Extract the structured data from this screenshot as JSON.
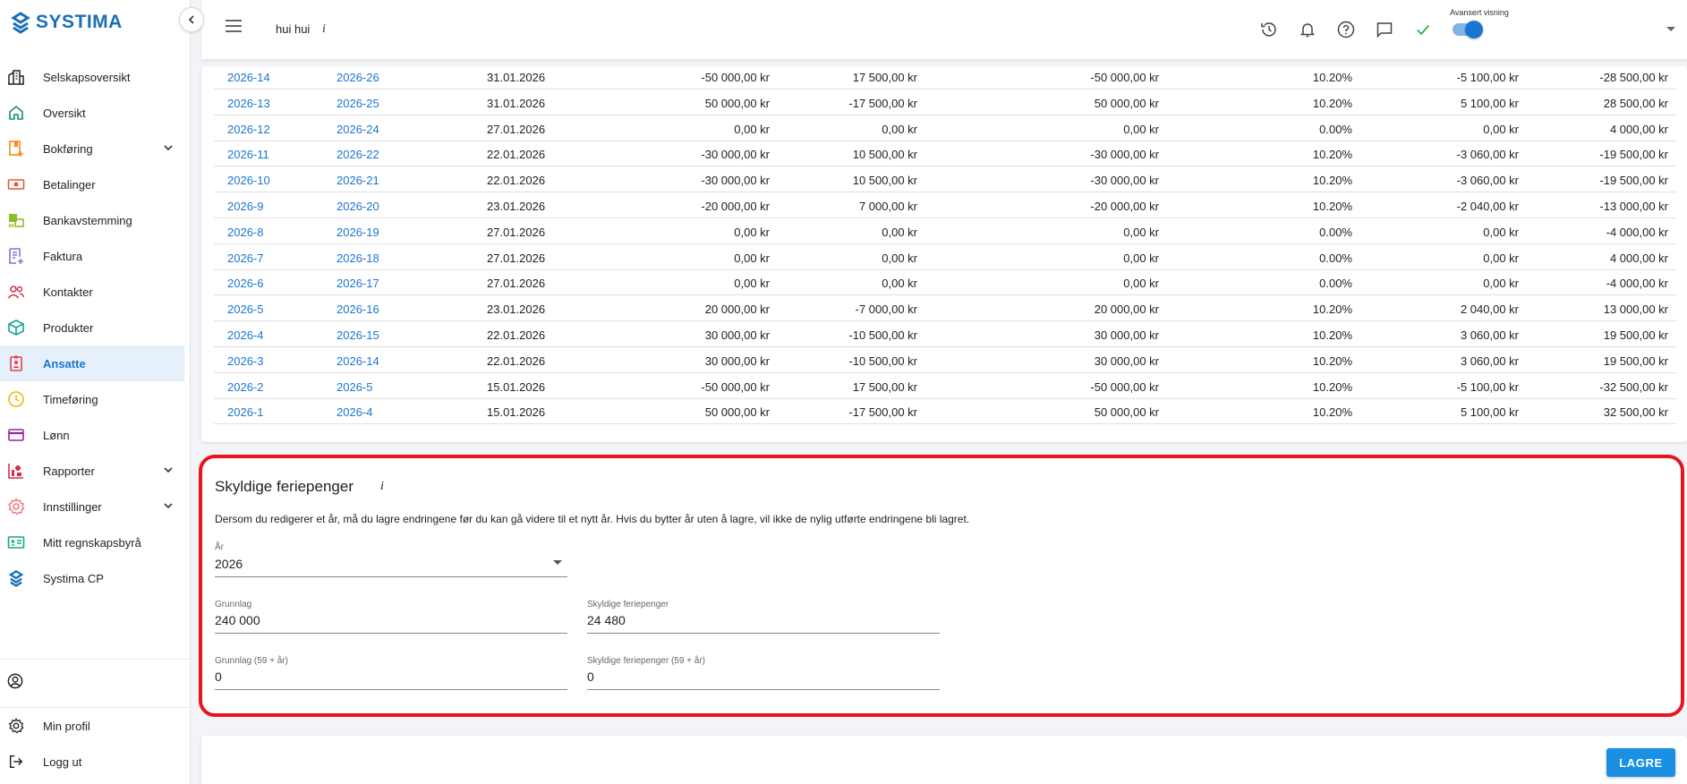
{
  "app": {
    "logo_text": "SYSTIMA",
    "brand_color": "#1a6fb5",
    "accent_color": "#1a76d2",
    "highlight_color": "#e8141e"
  },
  "sidebar": {
    "items": [
      {
        "label": "Selskapsoversikt",
        "icon": "buildings-icon"
      },
      {
        "label": "Oversikt",
        "icon": "home-icon"
      },
      {
        "label": "Bokføring",
        "icon": "ledger-icon",
        "expandable": true
      },
      {
        "label": "Betalinger",
        "icon": "payments-icon"
      },
      {
        "label": "Bankavstemming",
        "icon": "bank-reconciliation-icon"
      },
      {
        "label": "Faktura",
        "icon": "invoice-icon"
      },
      {
        "label": "Kontakter",
        "icon": "contacts-icon"
      },
      {
        "label": "Produkter",
        "icon": "box-icon"
      },
      {
        "label": "Ansatte",
        "icon": "employee-badge-icon",
        "active": true
      },
      {
        "label": "Timeføring",
        "icon": "clock-icon"
      },
      {
        "label": "Lønn",
        "icon": "card-icon"
      },
      {
        "label": "Rapporter",
        "icon": "reports-icon",
        "expandable": true
      },
      {
        "label": "Innstillinger",
        "icon": "gear-icon",
        "expandable": true
      },
      {
        "label": "Mitt regnskapsbyrå",
        "icon": "id-card-icon"
      },
      {
        "label": "Systima CP",
        "icon": "systima-logo-icon"
      }
    ],
    "bottom": {
      "profile_label": "Min profil",
      "logout_label": "Logg ut"
    }
  },
  "topbar": {
    "company_name": "hui hui",
    "info_glyph": "i",
    "advanced_view_label": "Avansert visning",
    "advanced_view_on": true
  },
  "table": {
    "rows": [
      [
        "2026-14",
        "2026-26",
        "31.01.2026",
        "-50 000,00 kr",
        "17 500,00 kr",
        "-50 000,00 kr",
        "10.20%",
        "-5 100,00 kr",
        "-28 500,00 kr"
      ],
      [
        "2026-13",
        "2026-25",
        "31.01.2026",
        "50 000,00 kr",
        "-17 500,00 kr",
        "50 000,00 kr",
        "10.20%",
        "5 100,00 kr",
        "28 500,00 kr"
      ],
      [
        "2026-12",
        "2026-24",
        "27.01.2026",
        "0,00 kr",
        "0,00 kr",
        "0,00 kr",
        "0.00%",
        "0,00 kr",
        "4 000,00 kr"
      ],
      [
        "2026-11",
        "2026-22",
        "22.01.2026",
        "-30 000,00 kr",
        "10 500,00 kr",
        "-30 000,00 kr",
        "10.20%",
        "-3 060,00 kr",
        "-19 500,00 kr"
      ],
      [
        "2026-10",
        "2026-21",
        "22.01.2026",
        "-30 000,00 kr",
        "10 500,00 kr",
        "-30 000,00 kr",
        "10.20%",
        "-3 060,00 kr",
        "-19 500,00 kr"
      ],
      [
        "2026-9",
        "2026-20",
        "23.01.2026",
        "-20 000,00 kr",
        "7 000,00 kr",
        "-20 000,00 kr",
        "10.20%",
        "-2 040,00 kr",
        "-13 000,00 kr"
      ],
      [
        "2026-8",
        "2026-19",
        "27.01.2026",
        "0,00 kr",
        "0,00 kr",
        "0,00 kr",
        "0.00%",
        "0,00 kr",
        "-4 000,00 kr"
      ],
      [
        "2026-7",
        "2026-18",
        "27.01.2026",
        "0,00 kr",
        "0,00 kr",
        "0,00 kr",
        "0.00%",
        "0,00 kr",
        "4 000,00 kr"
      ],
      [
        "2026-6",
        "2026-17",
        "27.01.2026",
        "0,00 kr",
        "0,00 kr",
        "0,00 kr",
        "0.00%",
        "0,00 kr",
        "-4 000,00 kr"
      ],
      [
        "2026-5",
        "2026-16",
        "23.01.2026",
        "20 000,00 kr",
        "-7 000,00 kr",
        "20 000,00 kr",
        "10.20%",
        "2 040,00 kr",
        "13 000,00 kr"
      ],
      [
        "2026-4",
        "2026-15",
        "22.01.2026",
        "30 000,00 kr",
        "-10 500,00 kr",
        "30 000,00 kr",
        "10.20%",
        "3 060,00 kr",
        "19 500,00 kr"
      ],
      [
        "2026-3",
        "2026-14",
        "22.01.2026",
        "30 000,00 kr",
        "-10 500,00 kr",
        "30 000,00 kr",
        "10.20%",
        "3 060,00 kr",
        "19 500,00 kr"
      ],
      [
        "2026-2",
        "2026-5",
        "15.01.2026",
        "-50 000,00 kr",
        "17 500,00 kr",
        "-50 000,00 kr",
        "10.20%",
        "-5 100,00 kr",
        "-32 500,00 kr"
      ],
      [
        "2026-1",
        "2026-4",
        "15.01.2026",
        "50 000,00 kr",
        "-17 500,00 kr",
        "50 000,00 kr",
        "10.20%",
        "5 100,00 kr",
        "32 500,00 kr"
      ]
    ]
  },
  "feriepenger": {
    "title": "Skyldige feriepenger",
    "info_glyph": "i",
    "description": "Dersom du redigerer et år, må du lagre endringene før du kan gå videre til et nytt år. Hvis du bytter år uten å lagre, vil ikke de nylig utførte endringene bli lagret.",
    "year_label": "År",
    "year_value": "2026",
    "grunnlag_label": "Grunnlag",
    "grunnlag_value": "240 000",
    "skyldige_label": "Skyldige feriepenger",
    "skyldige_value": "24 480",
    "grunnlag59_label": "Grunnlag (59 + år)",
    "grunnlag59_value": "0",
    "skyldige59_label": "Skyldige feriepenger (59 + år)",
    "skyldige59_value": "0"
  },
  "actions": {
    "save_label": "LAGRE"
  }
}
